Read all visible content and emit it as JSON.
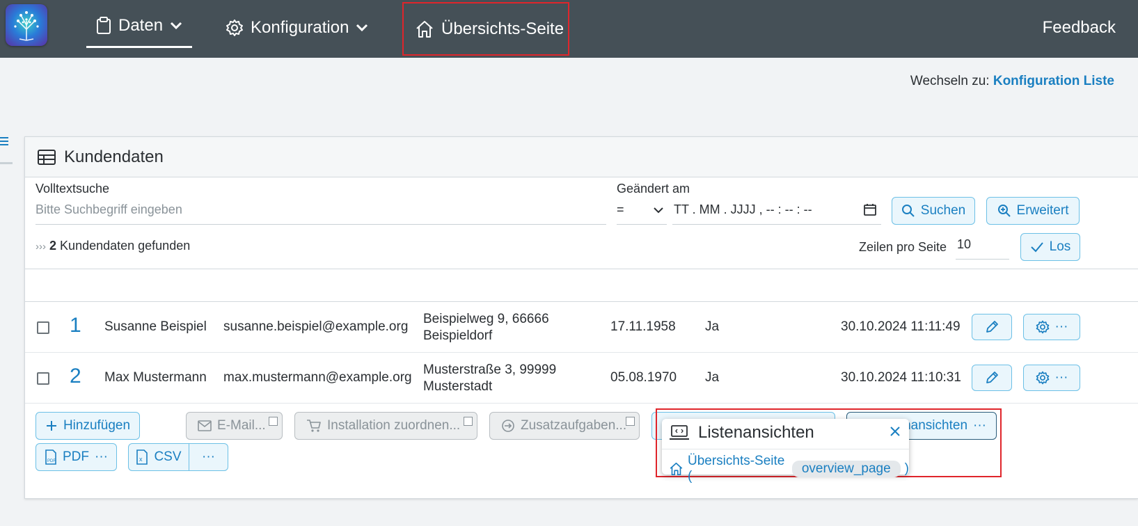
{
  "nav": {
    "items": [
      {
        "label": "Daten",
        "icon": "clipboard-icon"
      },
      {
        "label": "Konfiguration",
        "icon": "gear-icon"
      },
      {
        "label": "Übersichts-Seite",
        "icon": "home-icon"
      }
    ],
    "feedback": "Feedback"
  },
  "switch": {
    "prefix": "Wechseln zu:",
    "link": "Konfiguration Liste"
  },
  "panel": {
    "title": "Kundendaten"
  },
  "search": {
    "fulltext_label": "Volltextsuche",
    "fulltext_placeholder": "Bitte Suchbegriff eingeben",
    "changed_label": "Geändert am",
    "operator": "=",
    "date_placeholder": "TT . MM . JJJJ ,  -- : -- : --",
    "search_button": "Suchen",
    "advanced_button": "Erweitert"
  },
  "results": {
    "prefix": "›››",
    "count": "2",
    "suffix": "Kundendaten gefunden"
  },
  "paging": {
    "label": "Zeilen pro Seite",
    "value": "10",
    "go_button": "Los"
  },
  "rows": [
    {
      "num": "1",
      "name": "Susanne Beispiel",
      "email": "susanne.beispiel@example.org",
      "addr1": "Beispielweg 9, 66666",
      "addr2": "Beispieldorf",
      "date": "17.11.1958",
      "flag": "Ja",
      "ts": "30.10.2024 11:11:49"
    },
    {
      "num": "2",
      "name": "Max Mustermann",
      "email": "max.mustermann@example.org",
      "addr1": "Musterstraße 3, 99999",
      "addr2": "Musterstadt",
      "date": "05.08.1970",
      "flag": "Ja",
      "ts": "30.10.2024 11:10:31"
    }
  ],
  "actions": {
    "add": "Hinzufügen",
    "email": "E-Mail...",
    "install": "Installation zuordnen...",
    "extra": "Zusatzaufgaben...",
    "views_partial": "nansichten",
    "pdf": "PDF",
    "csv": "CSV",
    "more": "···"
  },
  "popup": {
    "title": "Listenansichten",
    "link_label": "Übersichts-Seite (",
    "code": "overview_page",
    "close_paren": ")"
  },
  "colors": {
    "nav_bg": "#455057",
    "accent": "#1a7fc1",
    "highlight": "#e0252b"
  }
}
